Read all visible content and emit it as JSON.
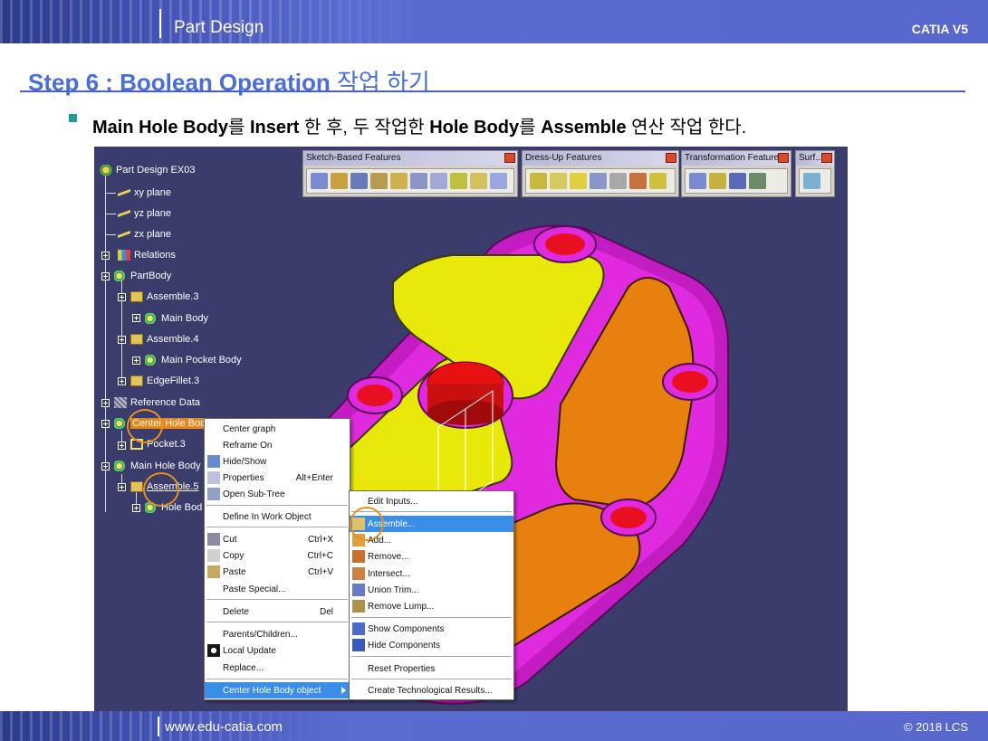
{
  "header": {
    "title": "Part Design",
    "brand": "CATIA V5"
  },
  "step": {
    "heading_en": "Step 6 : Boolean Operation",
    "heading_ko": " 작업 하기"
  },
  "bullet": {
    "p1": "Main Hole Body",
    "p2": "를 ",
    "p3": "Insert",
    "p4": " 한 후, 두 작업한 ",
    "p5": "Hole Body",
    "p6": "를 ",
    "p7": "Assemble",
    "p8": " 연산 작업 한다."
  },
  "toolbars": [
    {
      "title": "Sketch-Based Features"
    },
    {
      "title": "Dress-Up Features"
    },
    {
      "title": "Transformation Features"
    },
    {
      "title": "Surf..."
    }
  ],
  "tree": {
    "root": "Part Design EX03",
    "xy": "xy plane",
    "yz": "yz plane",
    "zx": "zx plane",
    "relations": "Relations",
    "partbody": "PartBody",
    "assemble3": "Assemble.3",
    "main_body": "Main Body",
    "assemble4": "Assemble.4",
    "main_pocket": "Main Pocket Body",
    "edgefillet": "EdgeFillet.3",
    "refdata": "Reference Data",
    "center_hole": "Center Hole Bod",
    "pocket3": "Pocket.3",
    "main_hole": "Main Hole Body",
    "assemble5": "Assemble.5",
    "hole_body": "Hole Bod"
  },
  "menu1": {
    "center_graph": "Center graph",
    "reframe_on": "Reframe On",
    "hide_show": "Hide/Show",
    "properties": "Properties",
    "properties_acc": "Alt+Enter",
    "open_subtree": "Open Sub-Tree",
    "define_work": "Define In Work Object",
    "cut": "Cut",
    "cut_acc": "Ctrl+X",
    "copy": "Copy",
    "copy_acc": "Ctrl+C",
    "paste": "Paste",
    "paste_acc": "Ctrl+V",
    "paste_special": "Paste Special...",
    "delete": "Delete",
    "delete_acc": "Del",
    "parents_children": "Parents/Children...",
    "local_update": "Local Update",
    "replace": "Replace...",
    "object": "Center Hole Body object"
  },
  "menu2": {
    "edit_inputs": "Edit Inputs...",
    "assemble": "Assemble...",
    "add": "Add...",
    "remove": "Remove...",
    "intersect": "Intersect...",
    "union_trim": "Union Trim...",
    "remove_lump": "Remove Lump...",
    "show_components": "Show Components",
    "hide_components": "Hide Components",
    "reset_properties": "Reset Properties",
    "create_tech": "Create Technological Results..."
  },
  "footer": {
    "url": "www.edu-catia.com",
    "copyright": "© 2018 LCS"
  },
  "colors": {
    "accent": "#4a6ed8",
    "header": "#5767cc",
    "viewport": "#3a3c6c",
    "selection": "#3a8ee6",
    "highlight": "#e8861c"
  }
}
